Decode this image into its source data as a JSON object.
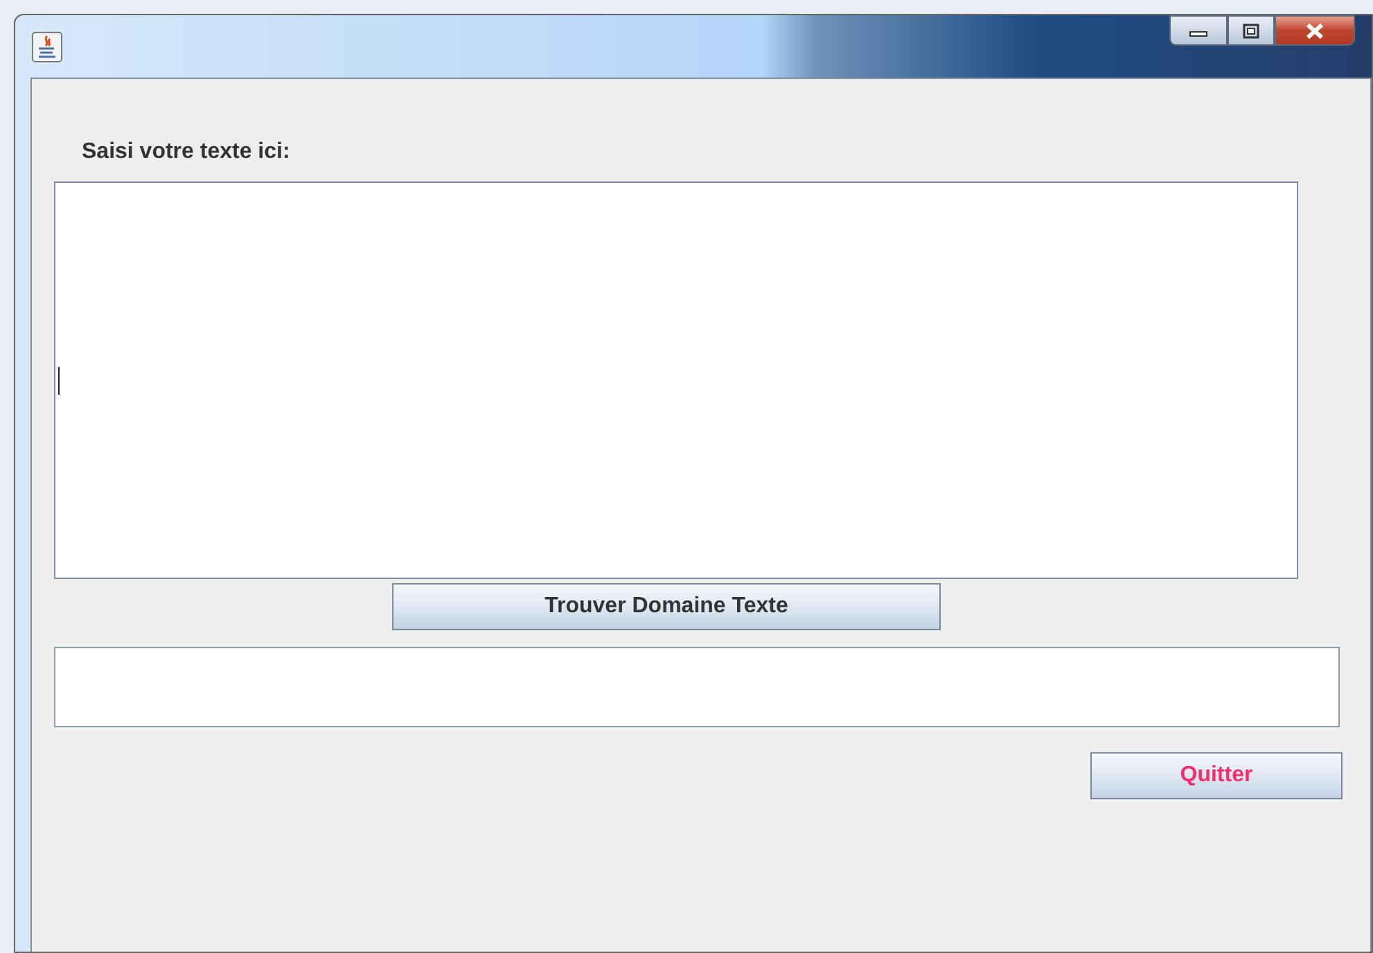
{
  "prompt_label": "Saisi votre texte ici:",
  "text_area": {
    "focused": true
  },
  "find_button": {
    "label": "Trouver Domaine Texte"
  },
  "result_field": {
    "focused": false
  },
  "quit_button": {
    "label": "Quitter"
  }
}
